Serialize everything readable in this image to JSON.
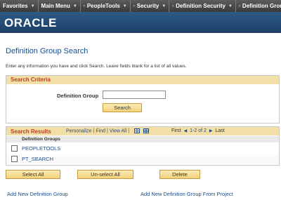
{
  "nav": {
    "favorites": "Favorites",
    "main_menu": "Main Menu",
    "peopletools": "PeopleTools",
    "security": "Security",
    "definition_security": "Definition Security",
    "definition_groups": "Definition Groups"
  },
  "header": {
    "logo": "ORACLE"
  },
  "page": {
    "title": "Definition Group Search",
    "instructions": "Enter any information you have and click Search. Leave fields blank for a list of all values."
  },
  "search_criteria": {
    "heading": "Search Criteria",
    "field_label": "Definition Group",
    "field_value": "",
    "search_button": "Search"
  },
  "results": {
    "heading": "Search Results",
    "personalize": "Personalize",
    "find": "Find",
    "view_all": "View All",
    "first": "First",
    "range": "1-2 of 2",
    "last": "Last",
    "column_header": "Definition Groups",
    "rows": [
      {
        "name": "PEOPLETOOLS",
        "checked": false
      },
      {
        "name": "PT_SEARCH",
        "checked": false
      }
    ]
  },
  "buttons": {
    "select_all": "Select All",
    "unselect_all": "Un-select All",
    "delete": "Delete"
  },
  "links": {
    "add_new": "Add New Definition Group",
    "add_from_project": "Add New Definition Group From Project"
  },
  "colors": {
    "nav_bg": "#4a4a4a",
    "banner_bg": "#25507a",
    "link": "#1c4c8c",
    "section_header_bg": "#f2dfa8",
    "section_header_text": "#b8431f",
    "button_bg": "#f6dc90"
  }
}
